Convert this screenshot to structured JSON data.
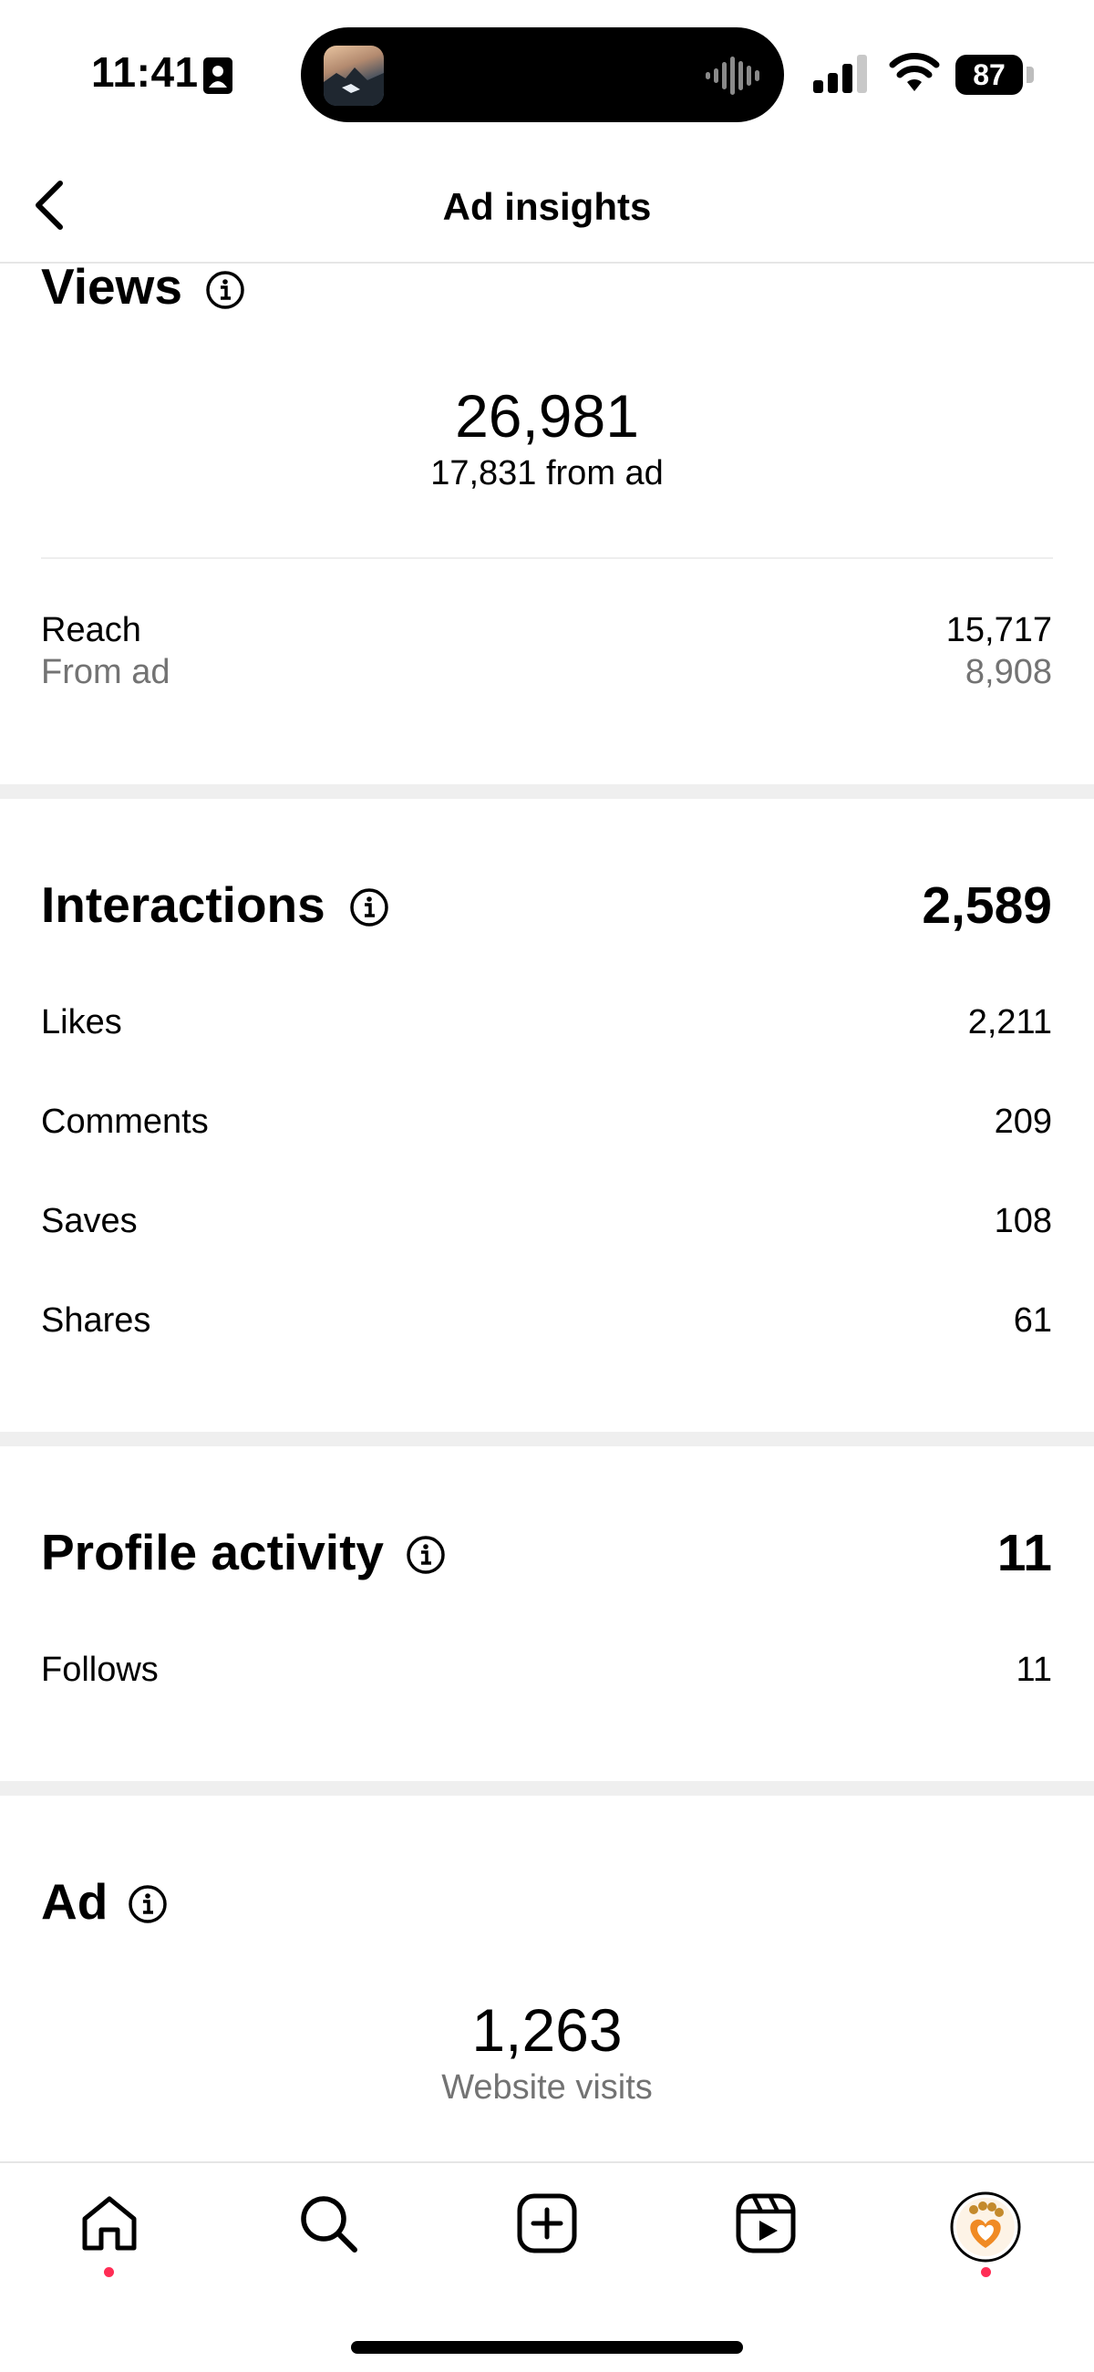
{
  "status_bar": {
    "time": "11:41",
    "battery": "87"
  },
  "header": {
    "title": "Ad insights"
  },
  "views": {
    "title": "Views",
    "total": "26,981",
    "from_ad": "17,831 from ad",
    "reach_label": "Reach",
    "reach_value": "15,717",
    "reach_from_ad_label": "From ad",
    "reach_from_ad_value": "8,908"
  },
  "interactions": {
    "title": "Interactions",
    "total": "2,589",
    "rows": [
      {
        "label": "Likes",
        "value": "2,211"
      },
      {
        "label": "Comments",
        "value": "209"
      },
      {
        "label": "Saves",
        "value": "108"
      },
      {
        "label": "Shares",
        "value": "61"
      }
    ]
  },
  "profile_activity": {
    "title": "Profile activity",
    "total": "11",
    "rows": [
      {
        "label": "Follows",
        "value": "11"
      }
    ]
  },
  "ad": {
    "title": "Ad",
    "value": "1,263",
    "label": "Website visits"
  },
  "nav": {
    "items": [
      "home-icon",
      "search-icon",
      "create-icon",
      "reels-icon",
      "profile-avatar"
    ],
    "notification_color": "#ff2d55"
  }
}
